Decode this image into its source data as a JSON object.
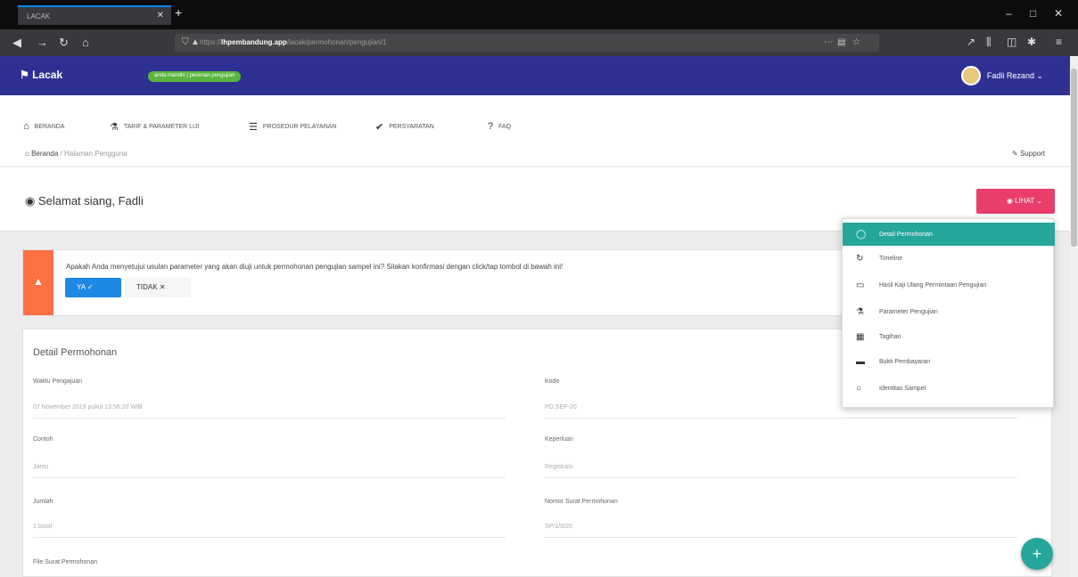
{
  "browser": {
    "tab_title": "LACAK",
    "tab_close": "✕",
    "new_tab": "+",
    "url_prefix": "https://",
    "url_host": "lhpembandung.app",
    "url_path": "/lacak/permohonan/pengujian/1",
    "url_page_actions": "⋯",
    "win_min": "–",
    "win_max": "□",
    "win_close": "✕"
  },
  "app": {
    "logo_text": "Lacak",
    "env_badge": "anda mandiri | pesenan pengujian",
    "user_name": "Fadli Rezand ⌄"
  },
  "menu": {
    "items": [
      {
        "label": "BERANDA",
        "icon": "⌂"
      },
      {
        "label": "TARIF & PARAMETER LIJI",
        "icon": "⚗"
      },
      {
        "label": "PROSEDUR PELAYANAN",
        "icon": "☰"
      },
      {
        "label": "PERSYARATAN",
        "icon": "✔"
      },
      {
        "label": "FAQ",
        "icon": "?"
      }
    ]
  },
  "breadcrumb": {
    "home": "Beranda",
    "sep": "/",
    "current": "Halaman Pengguna"
  },
  "support_label": "Support",
  "greeting": "Selamat siang, Fadli",
  "lihat_label": "LIHAT ⌄",
  "alert": {
    "icon": "▲",
    "message": "Apakah Anda menyetujui usulan parameter yang akan diuji untuk permohonan pengujian sampel ini? Silakan konfirmasi dengan click/tap tombol di bawah ini!",
    "ya_label": "YA ✓",
    "tidak_label": "TIDAK ✕"
  },
  "detail": {
    "title": "Detail Permohonan",
    "fields": [
      {
        "label": "Waktu Pengajuan",
        "value": "07 November 2019 pukul 13:56:20 WIB"
      },
      {
        "label": "Kode",
        "value": "PD.SEP-20"
      },
      {
        "label": "Contoh",
        "value": "Jamu"
      },
      {
        "label": "Keperluan",
        "value": "Registrasi"
      },
      {
        "label": "Jumlah",
        "value": "1 botol"
      },
      {
        "label": "Nomor Surat Permohonan",
        "value": "SP/1/9/20"
      },
      {
        "label": "File Surat Permohonan",
        "value": ""
      }
    ]
  },
  "dropdown": {
    "items": [
      {
        "label": "Detail Permohonan",
        "icon": "◯"
      },
      {
        "label": "Timeline",
        "icon": "↻"
      },
      {
        "label": "Hasil Kaji Ulang Permintaan Pengujian",
        "icon": "▭"
      },
      {
        "label": "Parameter Pengujian",
        "icon": "⚗"
      },
      {
        "label": "Tagihan",
        "icon": "▦"
      },
      {
        "label": "Bukti Pembayaran",
        "icon": "▬"
      },
      {
        "label": "Identitas Sampel",
        "icon": "○"
      }
    ]
  },
  "fab_label": "+"
}
